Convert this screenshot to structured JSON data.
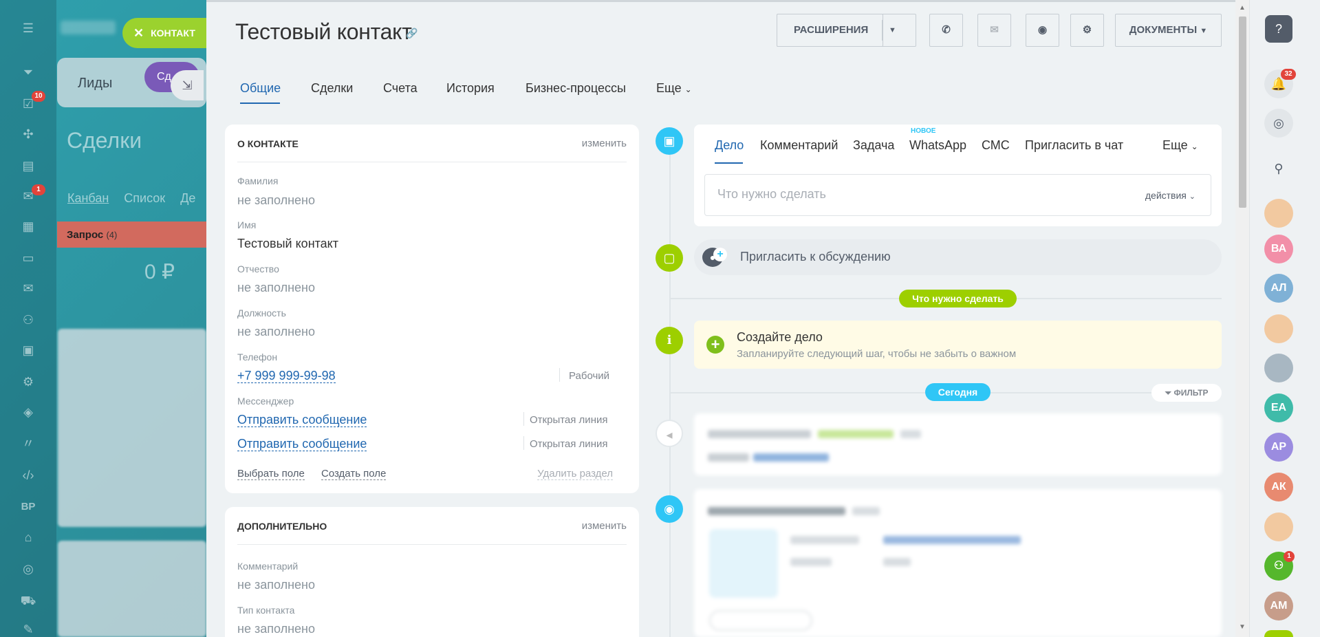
{
  "background": {
    "left_menu_badges": [
      "10",
      "1"
    ],
    "tabs": {
      "leads": "Лиды",
      "deals_short": "Сд"
    },
    "page_title": "Сделки",
    "view_links": [
      "Канбан",
      "Список",
      "Де"
    ],
    "column": {
      "title": "Запрос",
      "count": "(4)",
      "sum": "0 ₽"
    },
    "bp_label": "BP",
    "close_label": "КОНТАКТ"
  },
  "contact": {
    "title": "Тестовый контакт",
    "toolbar": {
      "extensions": "РАСШИРЕНИЯ",
      "documents": "ДОКУМЕНТЫ"
    },
    "tabs": [
      "Общие",
      "Сделки",
      "Счета",
      "История",
      "Бизнес-процессы",
      "Еще"
    ],
    "about": {
      "header": "О КОНТАКТЕ",
      "edit": "изменить",
      "fields": {
        "last_name_label": "Фамилия",
        "last_name_value": "не заполнено",
        "first_name_label": "Имя",
        "first_name_value": "Тестовый контакт",
        "patronymic_label": "Отчество",
        "patronymic_value": "не заполнено",
        "position_label": "Должность",
        "position_value": "не заполнено",
        "phone_label": "Телефон",
        "phone_value": "+7 999 999-99-98",
        "phone_type": "Рабочий",
        "messenger_label": "Мессенджер",
        "messenger_1": "Отправить сообщение",
        "messenger_1_type": "Открытая линия",
        "messenger_2": "Отправить сообщение",
        "messenger_2_type": "Открытая линия"
      },
      "actions": {
        "select_field": "Выбрать поле",
        "create_field": "Создать поле",
        "delete_section": "Удалить раздел"
      }
    },
    "extra": {
      "header": "ДОПОЛНИТЕЛЬНО",
      "edit": "изменить",
      "comment_label": "Комментарий",
      "comment_value": "не заполнено",
      "type_label": "Тип контакта",
      "type_value": "не заполнено"
    },
    "timeline": {
      "editor_tabs": [
        "Дело",
        "Комментарий",
        "Задача",
        "WhatsApp",
        "СМС",
        "Пригласить в чат",
        "Еще"
      ],
      "new_badge": "НОВОЕ",
      "placeholder": "Что нужно сделать",
      "actions": "действия",
      "invite": "Пригласить к обсуждению",
      "todo_pill": "Что нужно сделать",
      "todo_title": "Создайте дело",
      "todo_subtitle": "Запланируйте следующий шаг, чтобы не забыть о важном",
      "today_pill": "Сегодня",
      "filter": "ФИЛЬТР"
    }
  },
  "right_bar": {
    "notifications_badge": "32",
    "avatars": [
      "ВА",
      "АЛ",
      "ЕА",
      "АР",
      "АК",
      "АМ"
    ],
    "group_badge": "1"
  },
  "colors": {
    "accent": "#2067b0",
    "green": "#9bd22e",
    "sky": "#2fc6f6",
    "todo_bg": "#fffbe6"
  }
}
